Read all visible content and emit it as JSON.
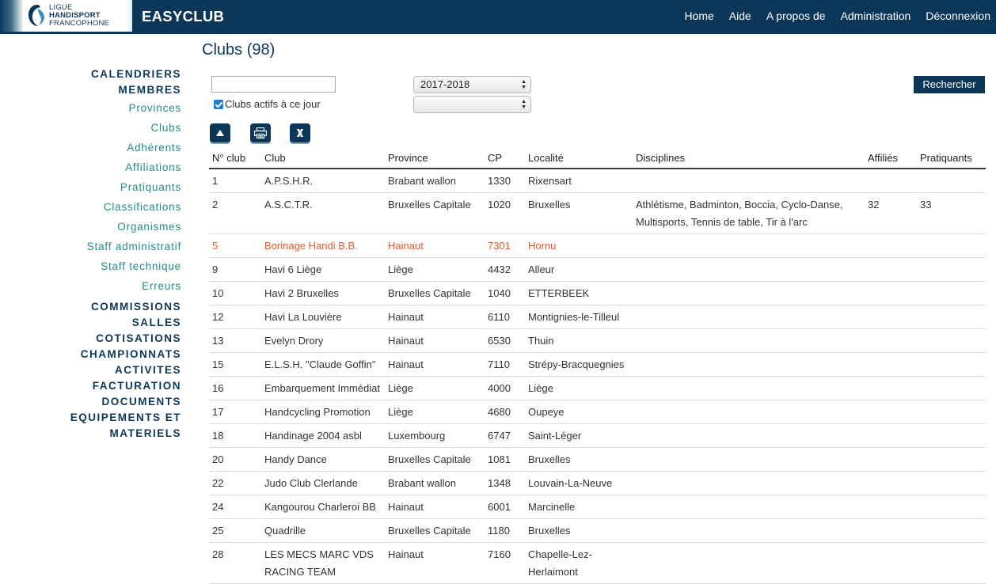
{
  "app": {
    "logo_lines": [
      "LIGUE",
      "HANDISPORT",
      "FRANCOPHONE"
    ],
    "name": "EASYCLUB"
  },
  "topnav": [
    "Home",
    "Aide",
    "A propos de",
    "Administration",
    "Déconnexion"
  ],
  "sidebar": [
    {
      "label": "CALENDRIERS",
      "level": 1
    },
    {
      "label": "MEMBRES",
      "level": 1
    },
    {
      "label": "Provinces",
      "level": 2
    },
    {
      "label": "Clubs",
      "level": 2
    },
    {
      "label": "Adhérents",
      "level": 2
    },
    {
      "label": "Affiliations",
      "level": 2
    },
    {
      "label": "Pratiquants",
      "level": 2
    },
    {
      "label": "Classifications",
      "level": 2
    },
    {
      "label": "Organismes",
      "level": 2
    },
    {
      "label": "Staff administratif",
      "level": 2
    },
    {
      "label": "Staff technique",
      "level": 2
    },
    {
      "label": "Erreurs",
      "level": 2
    },
    {
      "label": "COMMISSIONS",
      "level": 1
    },
    {
      "label": "SALLES",
      "level": 1
    },
    {
      "label": "COTISATIONS",
      "level": 1
    },
    {
      "label": "CHAMPIONNATS",
      "level": 1
    },
    {
      "label": "ACTIVITES",
      "level": 1
    },
    {
      "label": "FACTURATION",
      "level": 1
    },
    {
      "label": "DOCUMENTS",
      "level": 1
    },
    {
      "label": "EQUIPEMENTS ET MATERIELS",
      "level": 1
    }
  ],
  "main": {
    "title": "Clubs (98)",
    "search_value": "",
    "active_checkbox_label": "Clubs actifs à ce jour",
    "active_checked": true,
    "season_select": "2017-2018",
    "second_select": "",
    "search_button": "Rechercher",
    "icons": [
      "up-arrow-icon",
      "print-icon",
      "excel-icon"
    ]
  },
  "table": {
    "columns": [
      "N° club",
      "Club",
      "Province",
      "CP",
      "Localité",
      "Disciplines",
      "Affiliés",
      "Pratiquants"
    ],
    "rows": [
      [
        "1",
        "A.P.S.H.R.",
        "Brabant wallon",
        "1330",
        "Rixensart",
        "",
        "",
        ""
      ],
      [
        "2",
        "A.S.C.T.R.",
        "Bruxelles Capitale",
        "1020",
        "Bruxelles",
        "Athlétisme, Badminton, Boccia, Cyclo-Danse, Multisports, Tennis de table, Tir à l'arc",
        "32",
        "33"
      ],
      [
        "5",
        "Borinage Handi B.B.",
        "Hainaut",
        "7301",
        "Hornu",
        "",
        "",
        ""
      ],
      [
        "9",
        "Havi 6 Liège",
        "Liège",
        "4432",
        "Alleur",
        "",
        "",
        ""
      ],
      [
        "10",
        "Havi 2 Bruxelles",
        "Bruxelles Capitale",
        "1040",
        "ETTERBEEK",
        "",
        "",
        ""
      ],
      [
        "12",
        "Havi La Louvière",
        "Hainaut",
        "6110",
        "Montignies-le-Tilleul",
        "",
        "",
        ""
      ],
      [
        "13",
        "Evelyn Drory",
        "Hainaut",
        "6530",
        "Thuin",
        "",
        "",
        ""
      ],
      [
        "15",
        "E.L.S.H. \"Claude Goffin\"",
        "Hainaut",
        "7110",
        "Strépy-Bracquegnies",
        "",
        "",
        ""
      ],
      [
        "16",
        "Embarquement Immédiat",
        "Liège",
        "4000",
        "Liège",
        "",
        "",
        ""
      ],
      [
        "17",
        "Handcycling Promotion",
        "Liège",
        "4680",
        "Oupeye",
        "",
        "",
        ""
      ],
      [
        "18",
        "Handinage 2004 asbl",
        "Luxembourg",
        "6747",
        "Saint-Léger",
        "",
        "",
        ""
      ],
      [
        "20",
        "Handy Dance",
        "Bruxelles Capitale",
        "1081",
        "Bruxelles",
        "",
        "",
        ""
      ],
      [
        "22",
        "Judo Club Clerlande",
        "Brabant wallon",
        "1348",
        "Louvain-La-Neuve",
        "",
        "",
        ""
      ],
      [
        "24",
        "Kangourou Charleroi BB",
        "Hainaut",
        "6001",
        "Marcinelle",
        "",
        "",
        ""
      ],
      [
        "25",
        "Quadrille",
        "Bruxelles Capitale",
        "1180",
        "Bruxelles",
        "",
        "",
        ""
      ],
      [
        "28",
        "LES MECS MARC VDS RACING TEAM",
        "Hainaut",
        "7160",
        "Chapelle-Lez-Herlaimont",
        "",
        "",
        ""
      ]
    ],
    "highlighted_row_index": 2,
    "highlight_color": "#e35a2b"
  },
  "colors": {
    "navy": "#0c3759",
    "teal": "#1f8c86"
  }
}
